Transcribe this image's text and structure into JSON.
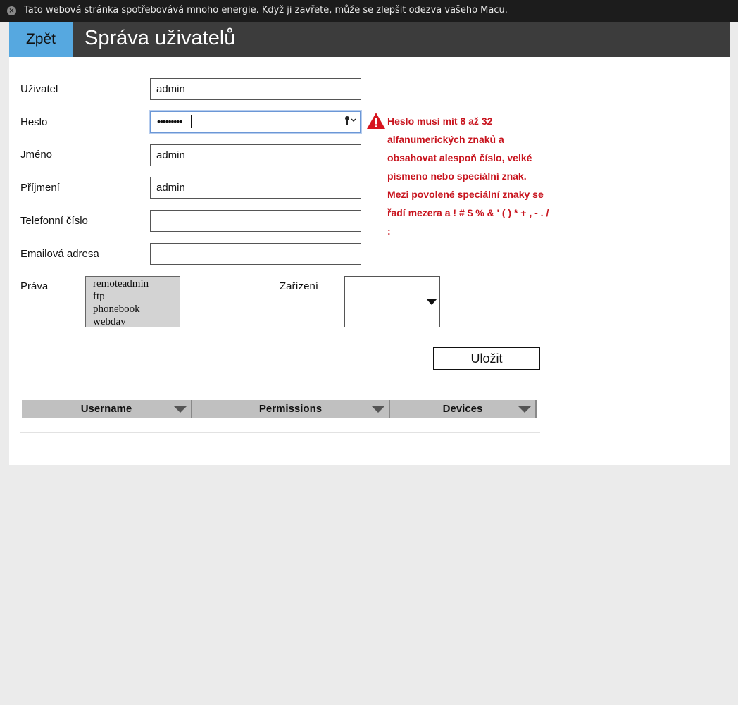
{
  "banner": {
    "message": "Tato webová stránka spotřebovává mnoho energie. Když ji zavřete, může se zlepšit odezva vašeho Macu."
  },
  "header": {
    "back_label": "Zpět",
    "title": "Správa uživatelů"
  },
  "form": {
    "username": {
      "label": "Uživatel",
      "value": "admin"
    },
    "password": {
      "label": "Heslo",
      "masked_value": "•••••••••"
    },
    "first_name": {
      "label": "Jméno",
      "value": "admin"
    },
    "last_name": {
      "label": "Příjmení",
      "value": "admin"
    },
    "phone": {
      "label": "Telefonní číslo",
      "value": ""
    },
    "email": {
      "label": "Emailová adresa",
      "value": ""
    },
    "rights": {
      "label": "Práva",
      "options": [
        "remoteadmin",
        "ftp",
        "phonebook",
        "webdav"
      ]
    },
    "devices": {
      "label": "Zařízení"
    },
    "save_label": "Uložit"
  },
  "warning": {
    "text": "Heslo musí mít 8 až 32 alfanumerických znaků a obsahovat alespoň číslo, velké písmeno nebo speciální znak. Mezi povolené speciální znaky se řadí mezera a ! # $ % & ' ( ) * + , - . / :",
    "color": "#c8141e"
  },
  "table": {
    "columns": [
      "Username",
      "Permissions",
      "Devices"
    ]
  },
  "colors": {
    "back_button": "#56a8e0",
    "header_bg": "#3c3c3c",
    "focus_border": "#6b97d6"
  }
}
